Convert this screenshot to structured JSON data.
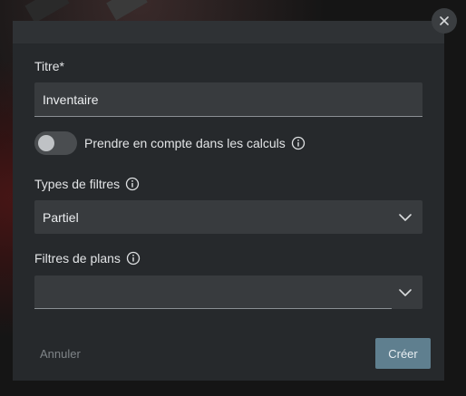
{
  "dialog": {
    "title_field": {
      "label": "Titre*",
      "value": "Inventaire"
    },
    "toggle": {
      "label": "Prendre en compte dans les calculs",
      "checked": false
    },
    "filter_type": {
      "label": "Types de filtres",
      "selected": "Partiel"
    },
    "plan_filters": {
      "label": "Filtres de plans",
      "selected": ""
    },
    "buttons": {
      "cancel_label": "Annuler",
      "create_label": "Créer"
    }
  },
  "icons": {
    "close": "close-icon",
    "info": "info-icon",
    "chevron": "chevron-down-icon"
  },
  "colors": {
    "dialog_bg": "#26292c",
    "field_bg": "#383b3e",
    "primary_button": "#5f7f8f"
  }
}
